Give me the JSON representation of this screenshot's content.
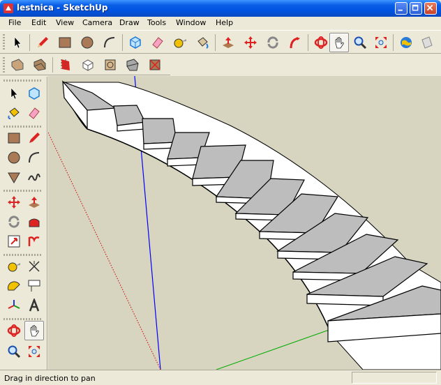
{
  "window": {
    "title": "lestnica - SketchUp"
  },
  "menu": {
    "items": [
      "File",
      "Edit",
      "View",
      "Camera",
      "Draw",
      "Tools",
      "Window",
      "Help"
    ]
  },
  "status": {
    "text": "Drag in direction to pan",
    "value_box": ""
  },
  "colors": {
    "titlebar": "#0054e3",
    "chrome": "#ece9d8",
    "viewport_bg": "#d7d5c0",
    "step_top": "#bdbdbd",
    "step_face": "#ffffff",
    "axis_blue": "#0000ff",
    "axis_green": "#00aa00",
    "axis_red_dotted": "#cc0000"
  },
  "toolbar_main": {
    "icons": [
      "select-icon",
      "pencil-icon",
      "rectangle-icon",
      "circle-icon",
      "arc-icon",
      "make-component-icon",
      "eraser-icon",
      "tape-measure-icon",
      "paint-bucket-icon",
      "push-pull-icon",
      "move-icon",
      "rotate-icon",
      "follow-me-icon",
      "orbit-icon",
      "pan-icon",
      "zoom-icon",
      "zoom-extents-icon",
      "google-earth-icon",
      "get-models-icon"
    ],
    "active": "pan-icon"
  },
  "toolbar_views": {
    "icons": [
      "xray-icon",
      "wireframe-icon",
      "hidden-line-icon",
      "shaded-icon",
      "shaded-texture-icon",
      "monochrome-icon",
      "front-view-icon"
    ]
  },
  "toolbar_left": {
    "icons": [
      "select-icon",
      "make-component-icon",
      "paint-bucket-icon",
      "eraser-icon",
      "rectangle-icon",
      "pencil-icon",
      "circle-icon",
      "arc-icon",
      "polygon-icon",
      "freehand-icon",
      "move-icon",
      "push-pull-icon",
      "rotate-icon",
      "follow-me-icon",
      "scale-icon",
      "offset-icon",
      "tape-measure-icon",
      "dimension-icon",
      "protractor-icon",
      "text-icon",
      "axes-icon",
      "3d-text-icon",
      "orbit-icon",
      "pan-icon",
      "zoom-icon",
      "zoom-window-icon"
    ],
    "active": "pan-icon"
  }
}
